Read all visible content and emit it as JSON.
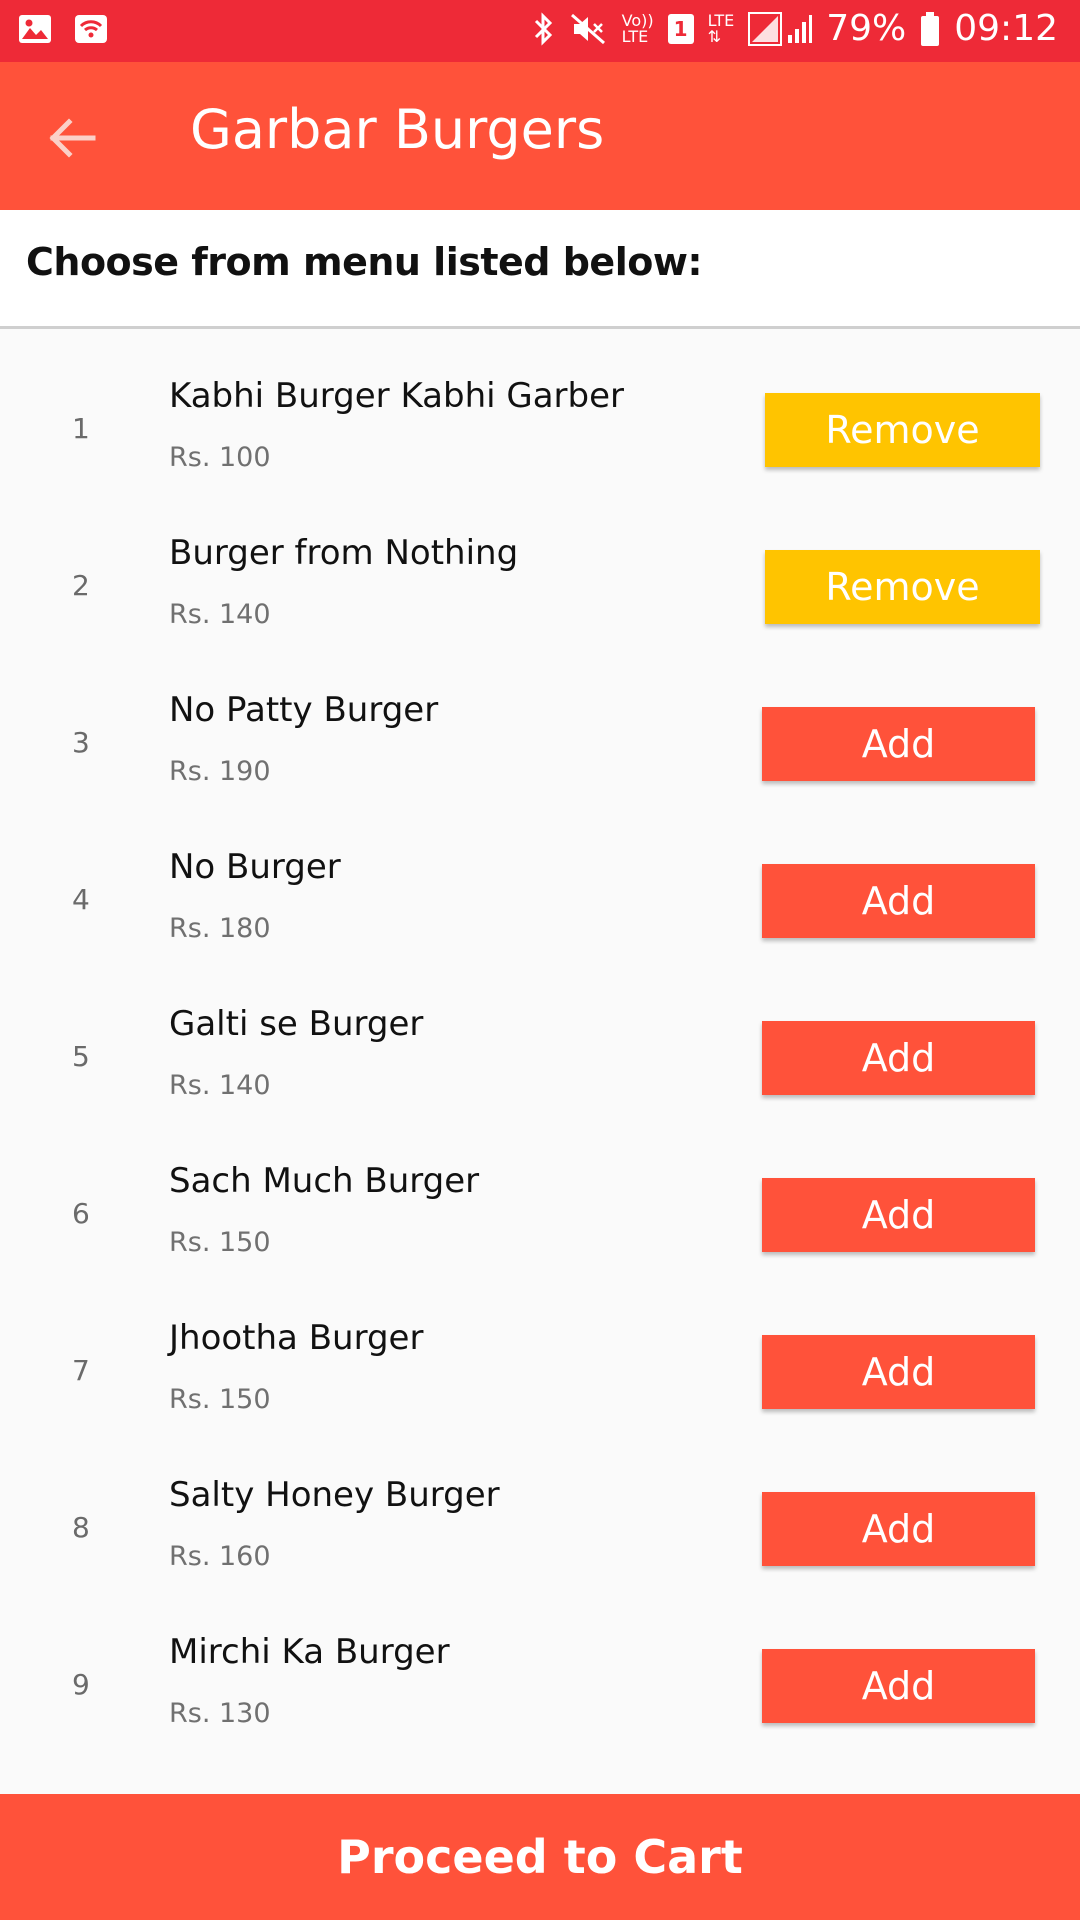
{
  "status_bar": {
    "battery": "79%",
    "time": "09:12",
    "volte_top": "Vo))",
    "volte_bottom": "LTE",
    "sim": "1",
    "lte": "LTE",
    "icons": [
      "gallery-icon",
      "wifi-icon",
      "bluetooth-icon",
      "mute-icon",
      "signal-icon",
      "battery-icon"
    ]
  },
  "app_bar": {
    "title": "Garbar Burgers",
    "back_icon": "arrow-back-icon"
  },
  "header": {
    "text": "Choose from menu listed below:"
  },
  "menu": {
    "items": [
      {
        "index": "1",
        "name": "Kabhi Burger Kabhi Garber",
        "price": "Rs. 100",
        "action": "Remove",
        "state": "remove"
      },
      {
        "index": "2",
        "name": "Burger from Nothing",
        "price": "Rs. 140",
        "action": "Remove",
        "state": "remove"
      },
      {
        "index": "3",
        "name": "No Patty Burger",
        "price": "Rs. 190",
        "action": "Add",
        "state": "add"
      },
      {
        "index": "4",
        "name": "No Burger",
        "price": "Rs. 180",
        "action": "Add",
        "state": "add"
      },
      {
        "index": "5",
        "name": "Galti se Burger",
        "price": "Rs. 140",
        "action": "Add",
        "state": "add"
      },
      {
        "index": "6",
        "name": "Sach Much Burger",
        "price": "Rs. 150",
        "action": "Add",
        "state": "add"
      },
      {
        "index": "7",
        "name": "Jhootha Burger",
        "price": "Rs. 150",
        "action": "Add",
        "state": "add"
      },
      {
        "index": "8",
        "name": "Salty Honey Burger",
        "price": "Rs. 160",
        "action": "Add",
        "state": "add"
      },
      {
        "index": "9",
        "name": "Mirchi Ka Burger",
        "price": "Rs. 130",
        "action": "Add",
        "state": "add"
      }
    ]
  },
  "footer": {
    "proceed_label": "Proceed to Cart"
  },
  "colors": {
    "status_bar": "#ee2a37",
    "primary": "#ff523a",
    "remove_button": "#ffc400",
    "background": "#fafafa"
  }
}
